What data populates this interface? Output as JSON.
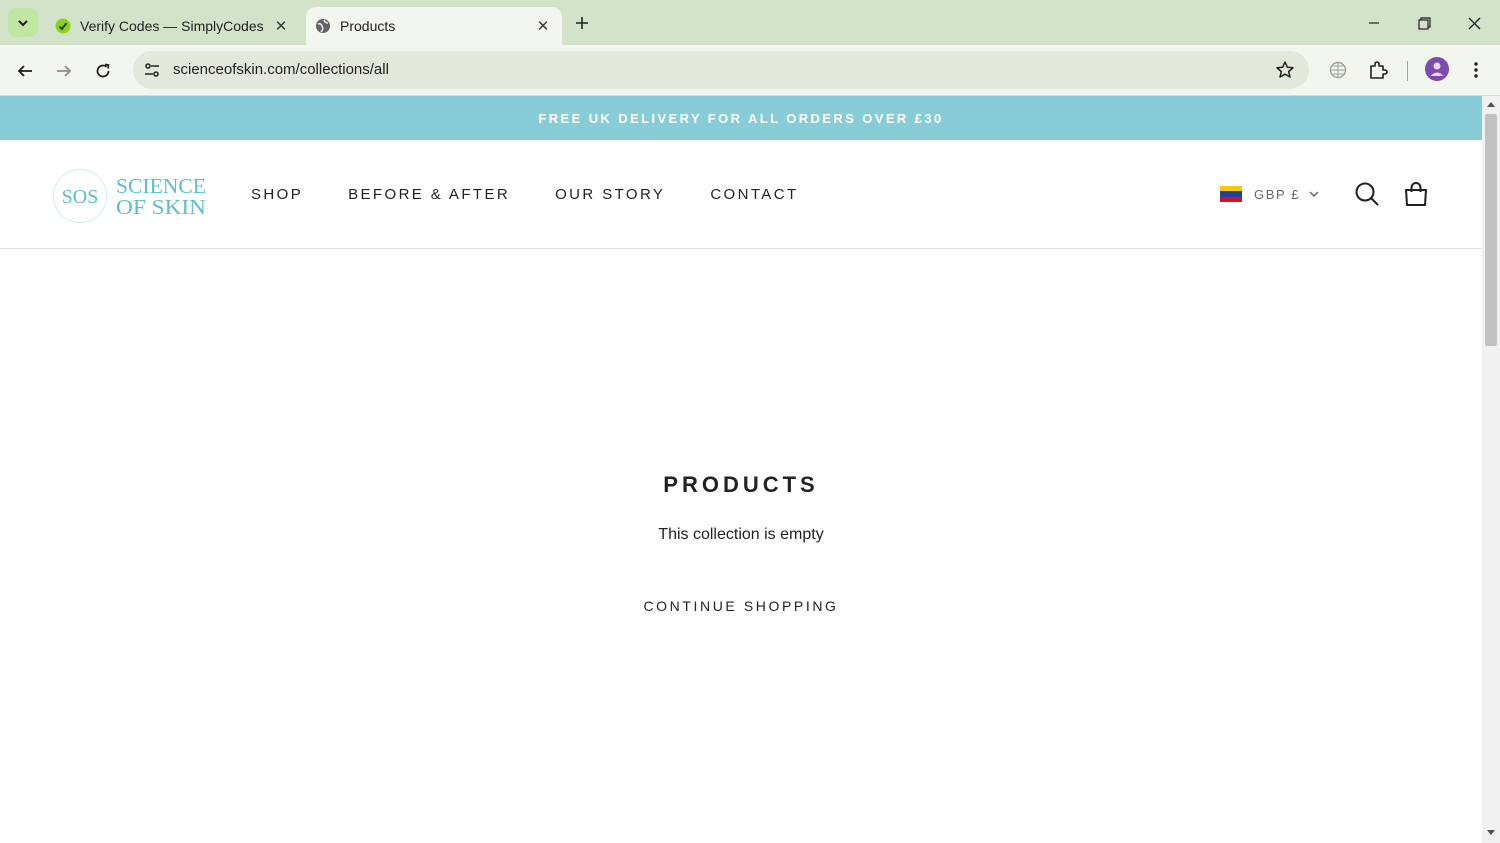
{
  "browser": {
    "tabs": [
      {
        "title": "Verify Codes — SimplyCodes",
        "active": false
      },
      {
        "title": "Products",
        "active": true
      }
    ],
    "url": "scienceofskin.com/collections/all"
  },
  "page": {
    "announcement": "FREE UK DELIVERY FOR ALL ORDERS OVER £30",
    "logo": {
      "mark": "SOS",
      "line1": "SCIENCE",
      "line2": "OF SKIN"
    },
    "nav": [
      "SHOP",
      "BEFORE & AFTER",
      "OUR STORY",
      "CONTACT"
    ],
    "currency": "GBP £",
    "title": "PRODUCTS",
    "empty_message": "This collection is empty",
    "cta": "CONTINUE SHOPPING"
  },
  "colors": {
    "announcement_bg": "#88ccd8",
    "brand_teal": "#5bbfcc"
  }
}
